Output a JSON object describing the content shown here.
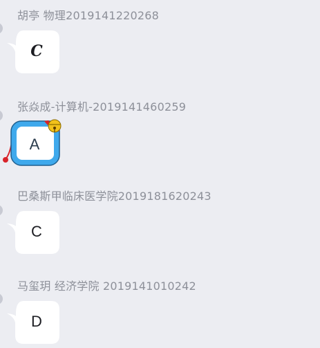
{
  "messages": [
    {
      "sender": "胡亭 物理2019141220268",
      "text": "C"
    },
    {
      "sender": "张焱成-计算机-2019141460259",
      "text": "A"
    },
    {
      "sender": "巴桑斯甲临床医学院2019181620243",
      "text": "C"
    },
    {
      "sender": "马玺玥 经济学院 2019141010242",
      "text": "D"
    }
  ],
  "colors": {
    "background": "#ecedf2",
    "bubble": "#ffffff",
    "sender_text": "#8d9099",
    "themed_bubble_blue": "#3fa9ec",
    "themed_bell": "#f2c21b",
    "themed_collar": "#d8232a"
  }
}
